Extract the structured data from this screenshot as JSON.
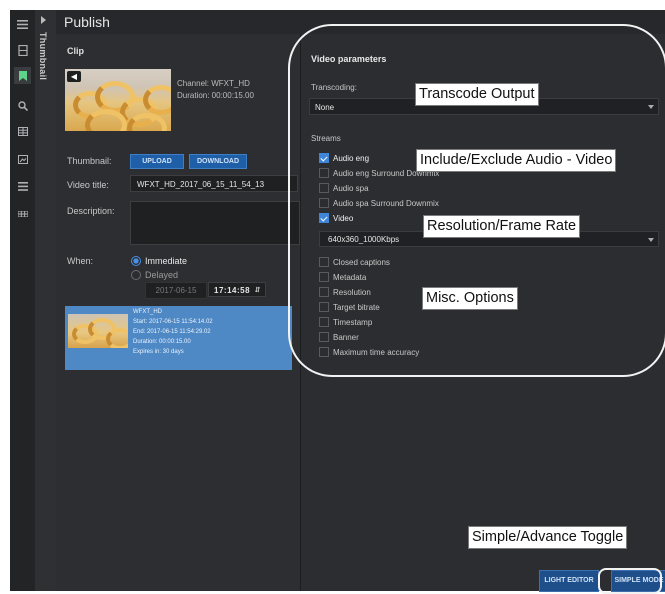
{
  "app": {
    "title": "Publish",
    "side_tab": "Thumbnail"
  },
  "rail_icons": [
    "menu-icon",
    "film-icon",
    "bookmark-icon",
    "search-icon",
    "grid-icon",
    "image-icon",
    "list-icon",
    "table-icon"
  ],
  "clip": {
    "heading": "Clip",
    "channel": "Channel: WFXT_HD",
    "duration": "Duration: 00:00:15.00",
    "thumbnail_label": "Thumbnail:",
    "upload_label": "UPLOAD",
    "download_label": "DOWNLOAD",
    "video_title_label": "Video title:",
    "video_title_value": "WFXT_HD_2017_06_15_11_54_13",
    "description_label": "Description:",
    "description_value": "",
    "when_label": "When:",
    "immediate_label": "Immediate",
    "delayed_label": "Delayed",
    "delayed_date": "2017-06-15",
    "delayed_time": "17:14:58",
    "selected_option": "Immediate"
  },
  "card": {
    "name": "WFXT_HD",
    "start": "Start: 2017-06-15 11:54:14.02",
    "end": "End: 2017-06-15 11:54:29.02",
    "duration": "Duration: 00:00:15.00",
    "expires": "Expires in: 30 days"
  },
  "video_params": {
    "heading": "Video parameters",
    "transcoding_label": "Transcoding:",
    "transcoding_value": "None",
    "streams_label": "Streams",
    "resolution_value": "640x360_1000Kbps"
  },
  "streams": [
    {
      "label": "Audio eng",
      "checked": true
    },
    {
      "label": "Audio eng Surround Downmix",
      "checked": false
    },
    {
      "label": "Audio spa",
      "checked": false
    },
    {
      "label": "Audio spa Surround Downmix",
      "checked": false
    },
    {
      "label": "Video",
      "checked": true
    }
  ],
  "options": [
    {
      "label": "Closed captions",
      "checked": false
    },
    {
      "label": "Metadata",
      "checked": false
    },
    {
      "label": "Resolution",
      "checked": false
    },
    {
      "label": "Target bitrate",
      "checked": false
    },
    {
      "label": "Timestamp",
      "checked": false
    },
    {
      "label": "Banner",
      "checked": false
    },
    {
      "label": "Maximum time accuracy",
      "checked": false
    }
  ],
  "footer": {
    "light_editor": "LIGHT EDITOR",
    "simple_mode": "SIMPLE MODE"
  },
  "callouts": {
    "transcode": "Transcode Output",
    "audio_video": "Include/Exclude Audio - Video",
    "resolution": "Resolution/Frame Rate",
    "misc": "Misc. Options",
    "toggle": "Simple/Advance Toggle"
  },
  "colors": {
    "accent": "#4a90e2",
    "card": "#4e89c6",
    "active_icon": "#5fd38a"
  }
}
